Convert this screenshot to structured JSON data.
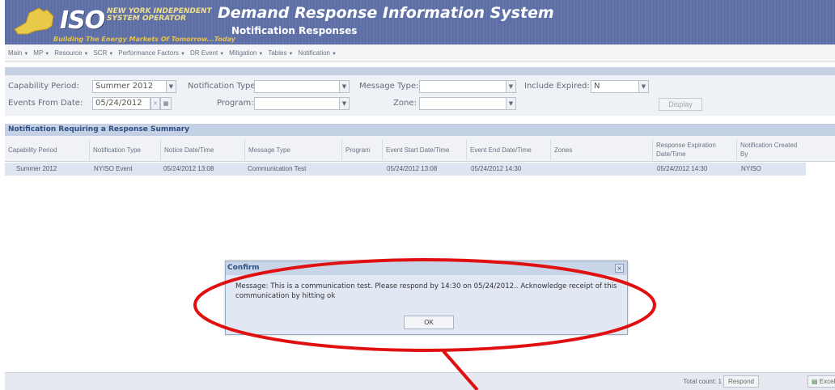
{
  "header": {
    "logo_iso": "ISO",
    "logo_name": "NEW YORK INDEPENDENT SYSTEM OPERATOR",
    "logo_tagline": "Building The Energy Markets Of Tomorrow...Today",
    "app_title": "Demand Response Information System",
    "page_subtitle": "Notification Responses"
  },
  "menu": [
    "Main",
    "MP",
    "Resource",
    "SCR",
    "Performance Factors",
    "DR Event",
    "Mitigation",
    "Tables",
    "Notification"
  ],
  "filters": {
    "capability_period_label": "Capability Period:",
    "capability_period_value": "Summer 2012",
    "notification_type_label": "Notification Type:",
    "notification_type_value": "",
    "message_type_label": "Message Type:",
    "message_type_value": "",
    "include_expired_label": "Include Expired:",
    "include_expired_value": "N",
    "events_from_date_label": "Events From Date:",
    "events_from_date_value": "05/24/2012",
    "program_label": "Program:",
    "program_value": "",
    "zone_label": "Zone:",
    "zone_value": "",
    "display_button": "Display"
  },
  "grid": {
    "title": "Notification Requiring a Response Summary",
    "columns": [
      "Capability Period",
      "Notification Type",
      "Notice Date/Time",
      "Message Type",
      "Program",
      "Event Start Date/Time",
      "Event End Date/Time",
      "Zones",
      "Response Expiration Date/Time",
      "Notification Created By"
    ],
    "rows": [
      [
        "Summer 2012",
        "NYISO Event",
        "05/24/2012 13:08",
        "Communication Test",
        "",
        "05/24/2012 13:08",
        "05/24/2012 14:30",
        "",
        "05/24/2012 14:30",
        "NYISO"
      ]
    ]
  },
  "footer": {
    "total_count": "Total count: 1",
    "respond_button": "Respond",
    "excel_button": "Excel"
  },
  "dialog": {
    "title": "Confirm",
    "message": "Message: This is a communication test. Please respond by 14:30 on 05/24/2012.. Acknowledge receipt of this communication by hitting ok",
    "ok_button": "OK"
  },
  "colors": {
    "header_blue": "#5e6fa6",
    "grid_title_text": "#2d4f83",
    "annotation_red": "#e01010"
  }
}
